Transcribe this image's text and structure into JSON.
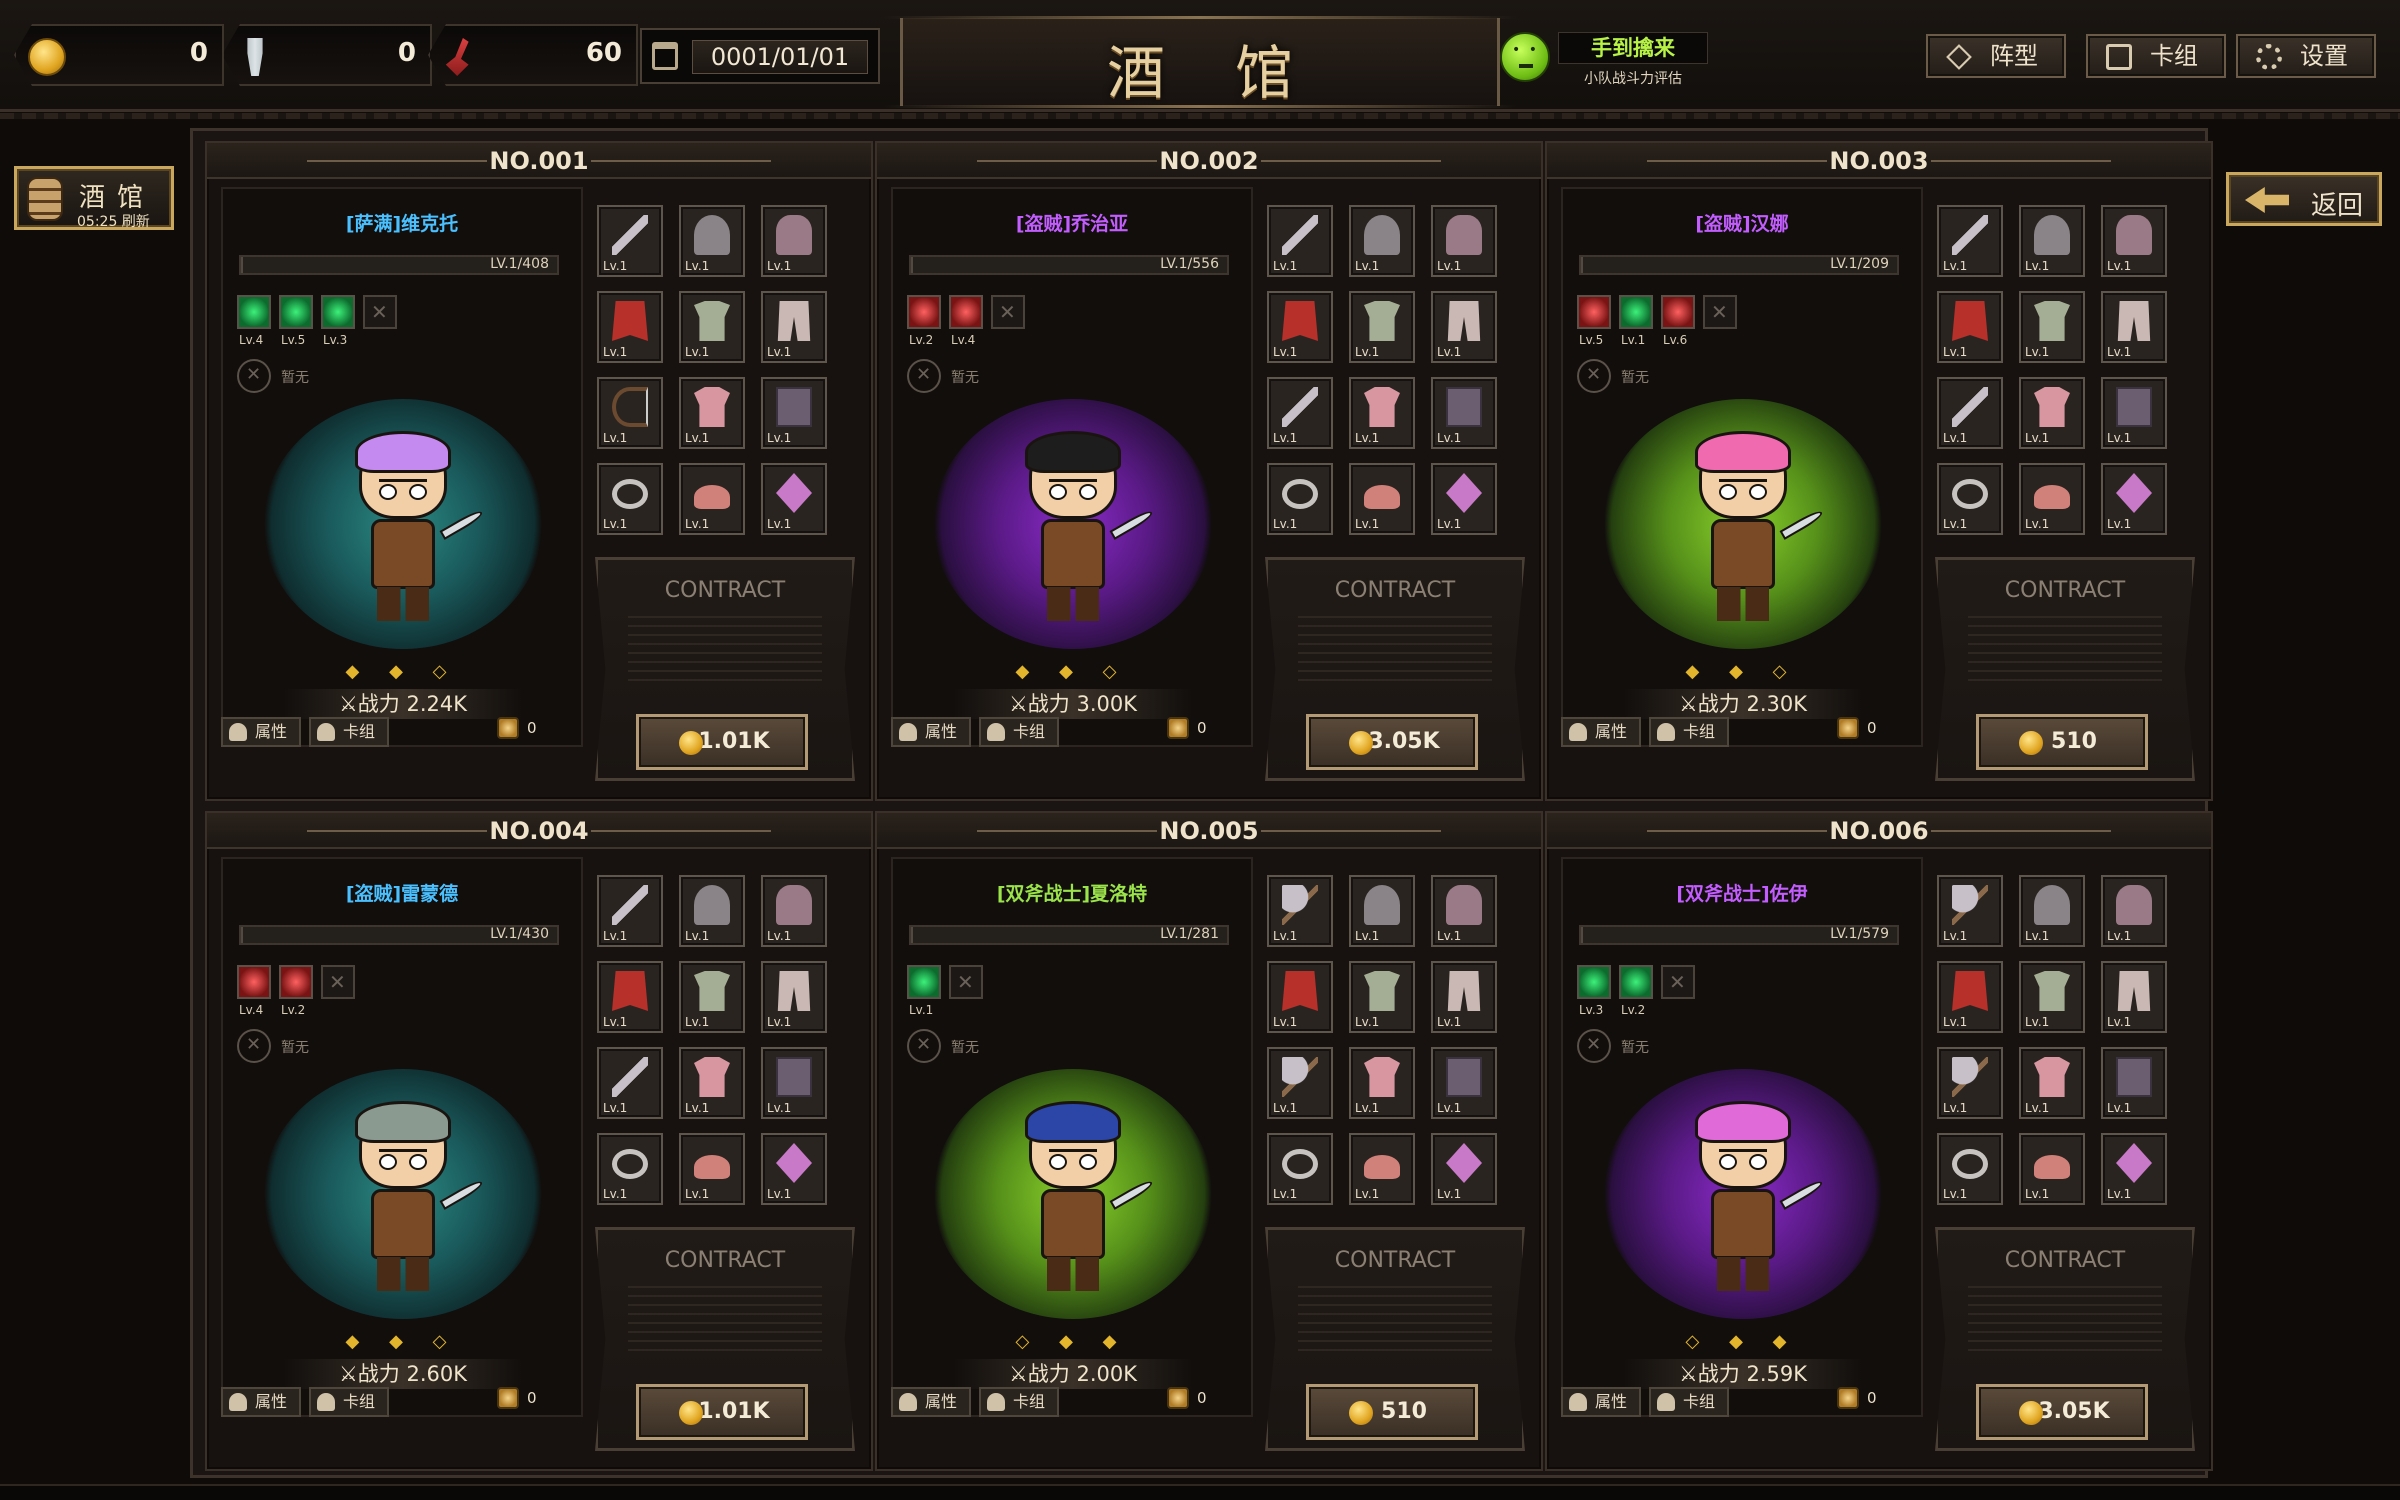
{
  "topbar": {
    "coins": "0",
    "screws": "0",
    "shovels": "60",
    "date": "0001/01/01",
    "title": "酒馆",
    "power_eval_label": "手到擒来",
    "power_eval_sub": "小队战斗力评估",
    "formation_label": "阵型",
    "deck_label": "卡组",
    "settings_label": "设置"
  },
  "side": {
    "tavern_label": "酒馆",
    "tavern_timer": "05:25 刷新",
    "back_label": "返回"
  },
  "common": {
    "contract_title": "CONTRACT",
    "passive_none": "暂无",
    "attr_label": "属性",
    "deck_label": "卡组"
  },
  "colors": {
    "shaman": "#4ac0ff",
    "rogue": "#c35dff",
    "dual_axe": "#9be34a",
    "accent_gold": "#e2b52c"
  },
  "heroes": [
    {
      "no": "NO.001",
      "name": "[萨满]维克托",
      "name_color": "#4ac0ff",
      "lv_text": "LV.1/408",
      "lv_fraction": 0.0025,
      "skills": [
        {
          "type": "green",
          "lv": "Lv.4"
        },
        {
          "type": "green",
          "lv": "Lv.5"
        },
        {
          "type": "green",
          "lv": "Lv.3"
        }
      ],
      "empty_skill_slots": 1,
      "aura": "teal",
      "hair": "#c58af0",
      "stars": "◆ ◆ ◇",
      "power": "⚔战力 2.24K",
      "equip": [
        "sword",
        "helm",
        "glove",
        "cape",
        "armor",
        "pants",
        "bow",
        "shirt",
        "book",
        "ring",
        "shoes",
        "amulet"
      ],
      "equip_lv": "Lv.1",
      "price": "1.01K",
      "cards": "0"
    },
    {
      "no": "NO.002",
      "name": "[盗贼]乔治亚",
      "name_color": "#c35dff",
      "lv_text": "LV.1/556",
      "lv_fraction": 0.0018,
      "skills": [
        {
          "type": "red",
          "lv": "Lv.2"
        },
        {
          "type": "red",
          "lv": "Lv.4"
        }
      ],
      "empty_skill_slots": 1,
      "aura": "purple",
      "hair": "#1d1d1d",
      "stars": "◆ ◆ ◇",
      "power": "⚔战力 3.00K",
      "equip": [
        "sword",
        "helm",
        "glove",
        "cape",
        "armor",
        "pants",
        "sword",
        "shirt",
        "book",
        "ring",
        "shoes",
        "amulet"
      ],
      "equip_lv": "Lv.1",
      "price": "3.05K",
      "cards": "0"
    },
    {
      "no": "NO.003",
      "name": "[盗贼]汉娜",
      "name_color": "#c35dff",
      "lv_text": "LV.1/209",
      "lv_fraction": 0.0048,
      "skills": [
        {
          "type": "red",
          "lv": "Lv.5"
        },
        {
          "type": "green",
          "lv": "Lv.1"
        },
        {
          "type": "red",
          "lv": "Lv.6"
        }
      ],
      "empty_skill_slots": 1,
      "aura": "lime",
      "hair": "#f06ab0",
      "stars": "◆ ◆ ◇",
      "power": "⚔战力 2.30K",
      "equip": [
        "sword",
        "helm",
        "glove",
        "cape",
        "armor",
        "pants",
        "sword",
        "shirt",
        "book",
        "ring",
        "shoes",
        "amulet"
      ],
      "equip_lv": "Lv.1",
      "price": "510",
      "cards": "0"
    },
    {
      "no": "NO.004",
      "name": "[盗贼]雷蒙德",
      "name_color": "#4ac0ff",
      "lv_text": "LV.1/430",
      "lv_fraction": 0.0023,
      "skills": [
        {
          "type": "red",
          "lv": "Lv.4"
        },
        {
          "type": "red",
          "lv": "Lv.2"
        }
      ],
      "empty_skill_slots": 1,
      "aura": "teal",
      "hair": "#8a9a90",
      "stars": "◆ ◆ ◇",
      "power": "⚔战力 2.60K",
      "equip": [
        "sword",
        "helm",
        "glove",
        "cape",
        "armor",
        "pants",
        "sword",
        "shirt",
        "book",
        "ring",
        "shoes",
        "amulet"
      ],
      "equip_lv": "Lv.1",
      "price": "1.01K",
      "cards": "0"
    },
    {
      "no": "NO.005",
      "name": "[双斧战士]夏洛特",
      "name_color": "#9be34a",
      "lv_text": "LV.1/281",
      "lv_fraction": 0.0036,
      "skills": [
        {
          "type": "green",
          "lv": "Lv.1"
        }
      ],
      "empty_skill_slots": 1,
      "aura": "lime",
      "hair": "#2b46a6",
      "stars": "◇ ◆ ◆",
      "power": "⚔战力 2.00K",
      "equip": [
        "axe",
        "helm",
        "glove",
        "cape",
        "armor",
        "pants",
        "axe",
        "shirt",
        "book",
        "ring",
        "shoes",
        "amulet"
      ],
      "equip_lv": "Lv.1",
      "price": "510",
      "cards": "0"
    },
    {
      "no": "NO.006",
      "name": "[双斧战士]佐伊",
      "name_color": "#c35dff",
      "lv_text": "LV.1/579",
      "lv_fraction": 0.0017,
      "skills": [
        {
          "type": "green",
          "lv": "Lv.3"
        },
        {
          "type": "green",
          "lv": "Lv.2"
        }
      ],
      "empty_skill_slots": 1,
      "aura": "purple",
      "hair": "#e06ad8",
      "stars": "◇ ◆ ◆",
      "power": "⚔战力 2.59K",
      "equip": [
        "axe",
        "helm",
        "glove",
        "cape",
        "armor",
        "pants",
        "axe",
        "shirt",
        "book",
        "ring",
        "shoes",
        "amulet"
      ],
      "equip_lv": "Lv.1",
      "price": "3.05K",
      "cards": "0"
    }
  ]
}
